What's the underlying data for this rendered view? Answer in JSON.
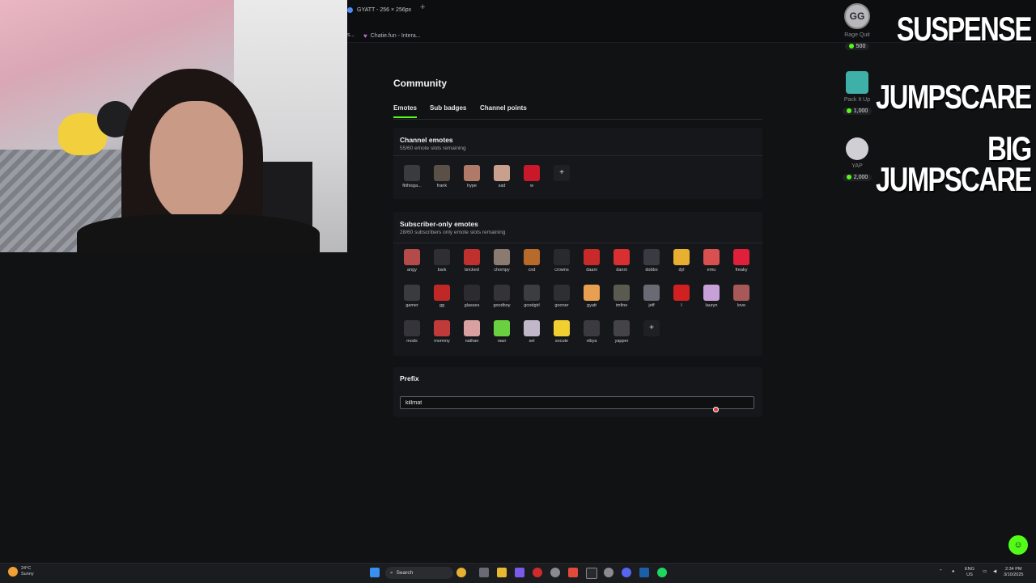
{
  "browser": {
    "tab_title": "GYATT - 256 × 256px",
    "tab_add": "+",
    "bookmark_left": "s...",
    "bookmark_label": "Chatie.fun - Intera..."
  },
  "community": {
    "title": "Community",
    "tabs": [
      {
        "label": "Emotes",
        "active": true
      },
      {
        "label": "Sub badges",
        "active": false
      },
      {
        "label": "Channel points",
        "active": false
      }
    ],
    "channel_emotes": {
      "title": "Channel emotes",
      "subtitle": "55/60 emote slots remaining",
      "emotes": [
        {
          "name": "fkthisga...",
          "color": "#3a3a40"
        },
        {
          "name": "frank",
          "color": "#5a5048"
        },
        {
          "name": "hype",
          "color": "#b07a68"
        },
        {
          "name": "sad",
          "color": "#c9a08e"
        },
        {
          "name": "w",
          "color": "#c8182a"
        }
      ],
      "add_label": "+"
    },
    "subscriber_emotes": {
      "title": "Subscriber-only emotes",
      "subtitle": "28/60 subscribers only emote slots remaining",
      "rows": [
        [
          {
            "name": "angy",
            "color": "#b54a4a"
          },
          {
            "name": "bark",
            "color": "#2e2e33"
          },
          {
            "name": "bricked",
            "color": "#c0302f"
          },
          {
            "name": "chompy",
            "color": "#8a7a70"
          },
          {
            "name": "cnd",
            "color": "#b86a2a"
          },
          {
            "name": "crowns",
            "color": "#2a2a2e"
          },
          {
            "name": "daani",
            "color": "#c82a2a"
          },
          {
            "name": "danni",
            "color": "#d83030"
          },
          {
            "name": "dobbo",
            "color": "#3a3a42"
          },
          {
            "name": "dyl",
            "color": "#e8b030"
          },
          {
            "name": "emu",
            "color": "#d85050"
          },
          {
            "name": "freaky",
            "color": "#e0203a"
          }
        ],
        [
          {
            "name": "gamer",
            "color": "#3a3a40"
          },
          {
            "name": "gg",
            "color": "#c02828"
          },
          {
            "name": "glasses",
            "color": "#2c2c30"
          },
          {
            "name": "goodboy",
            "color": "#333338"
          },
          {
            "name": "goodgirl",
            "color": "#3c3c42"
          },
          {
            "name": "gooner",
            "color": "#2e2e34"
          },
          {
            "name": "gyatt",
            "color": "#e8a050"
          },
          {
            "name": "imfine",
            "color": "#5a5a50"
          },
          {
            "name": "jeff",
            "color": "#6a6a74"
          },
          {
            "name": "l",
            "color": "#d02020"
          },
          {
            "name": "lauryn",
            "color": "#c8a0d8"
          },
          {
            "name": "love",
            "color": "#a85858"
          }
        ],
        [
          {
            "name": "mods",
            "color": "#34343a"
          },
          {
            "name": "mommy",
            "color": "#c03a3a"
          },
          {
            "name": "nathan",
            "color": "#d8a0a0"
          },
          {
            "name": "rawr",
            "color": "#6ad040"
          },
          {
            "name": "sel",
            "color": "#c0b8c8"
          },
          {
            "name": "socute",
            "color": "#f0d030"
          },
          {
            "name": "vibya",
            "color": "#3a3a40"
          },
          {
            "name": "yapper",
            "color": "#444448"
          }
        ]
      ],
      "add_label": "+"
    },
    "prefix": {
      "title": "Prefix",
      "value": "killrnat"
    }
  },
  "redeems": [
    {
      "label": "Rage Quit",
      "price": "500",
      "color": "#b8b8bc"
    },
    {
      "label": "Pack It Up",
      "price": "1,000",
      "color": "#3fb0a8"
    },
    {
      "label": "YAP",
      "price": "2,000",
      "color": "#d0d0d4"
    }
  ],
  "redeem_badge": "GG",
  "overlay_text": {
    "line1": "SUSPENSE",
    "line2": "JUMPSCARE",
    "line3a": "BIG",
    "line3b": "JUMPSCARE"
  },
  "taskbar": {
    "weather_temp": "24°C",
    "weather_cond": "Sunny",
    "search_placeholder": "Search",
    "lang_top": "ENG",
    "lang_bottom": "US",
    "time": "2:34 PM",
    "date": "3/10/2025"
  },
  "colors": {
    "accent": "#53fc18",
    "background": "#111214",
    "card": "#16171a"
  }
}
